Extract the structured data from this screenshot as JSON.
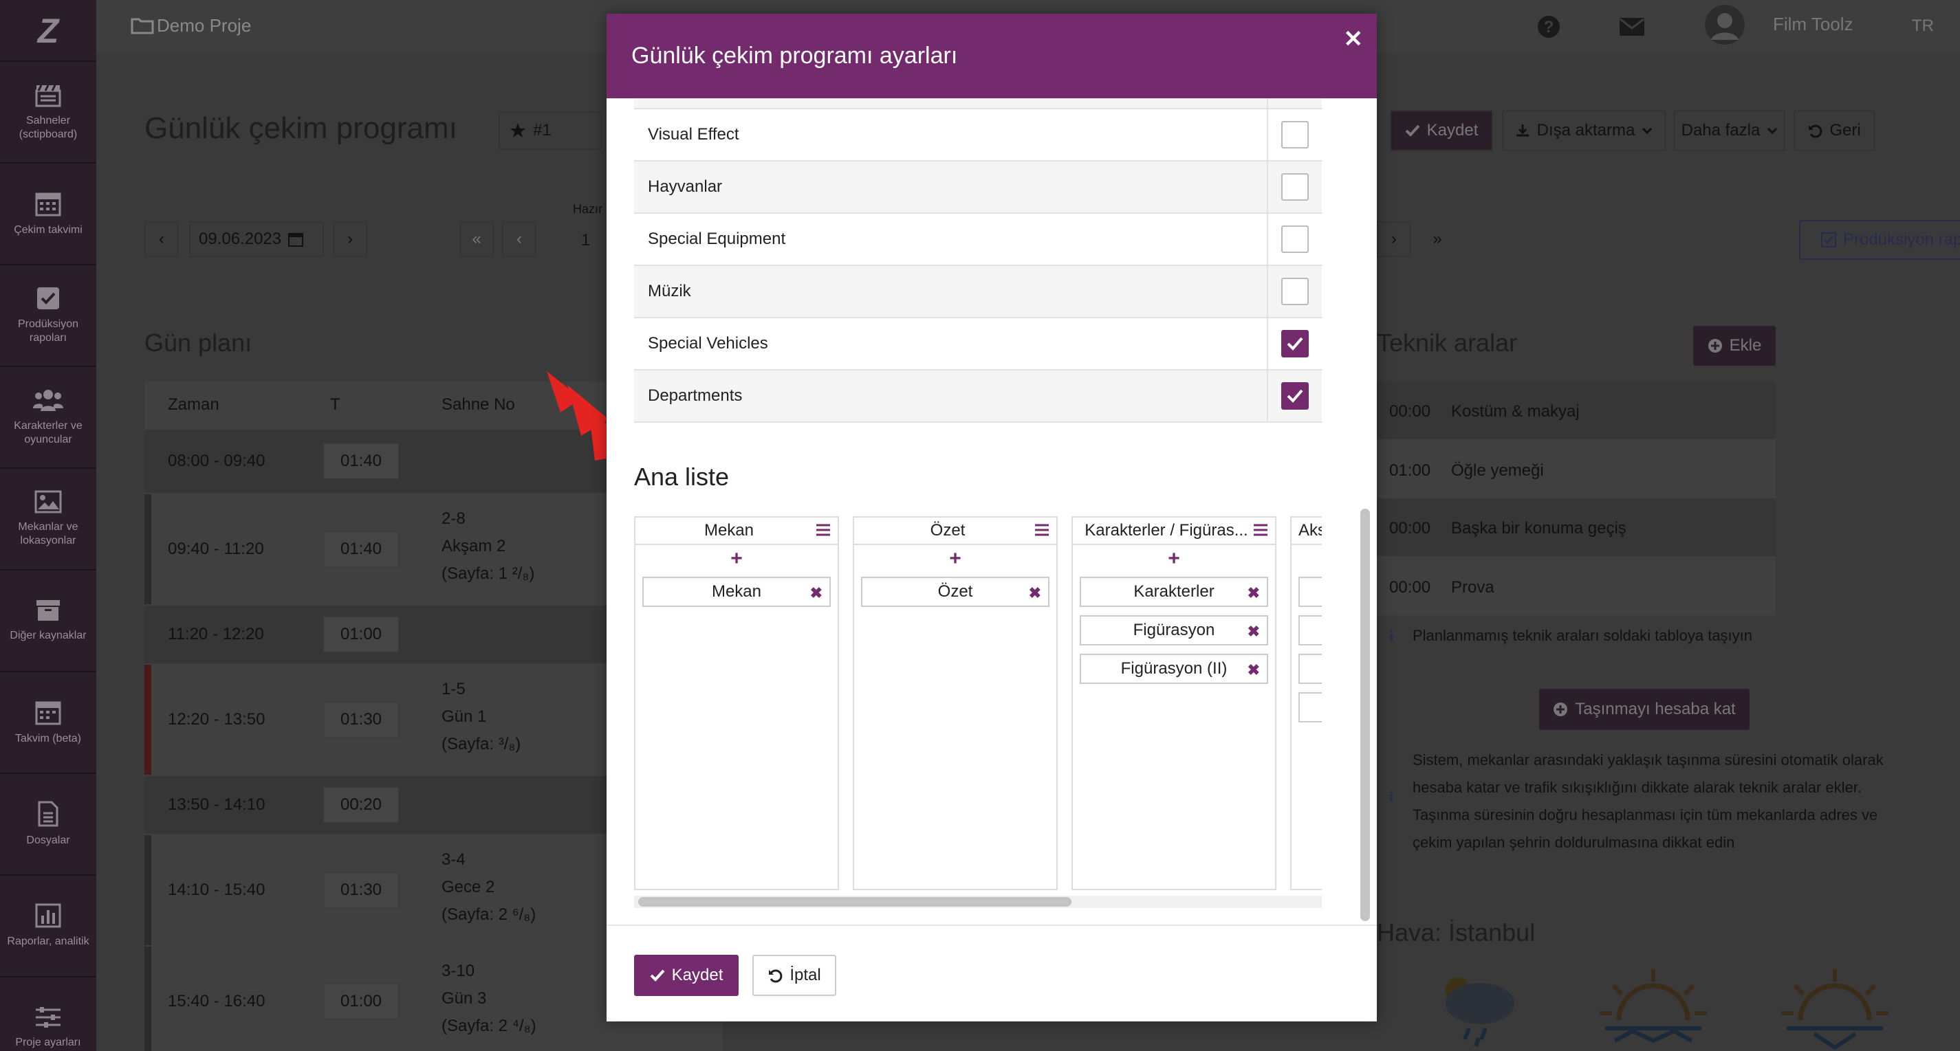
{
  "sidebar": {
    "logo": "Z",
    "items": [
      {
        "label": "Sahneler (sctipboard)",
        "icon": "clapperboard-icon"
      },
      {
        "label": "Çekim takvimi",
        "icon": "calendar-icon"
      },
      {
        "label": "Prodüksiyon rapoları",
        "icon": "checkbox-icon"
      },
      {
        "label": "Karakterler ve oyuncular",
        "icon": "users-icon"
      },
      {
        "label": "Mekanlar ve lokasyonlar",
        "icon": "image-icon"
      },
      {
        "label": "Diğer kaynaklar",
        "icon": "archive-icon"
      },
      {
        "label": "Takvim (beta)",
        "icon": "calendar-grid-icon"
      },
      {
        "label": "Dosyalar",
        "icon": "file-icon"
      },
      {
        "label": "Raporlar, analitik",
        "icon": "bar-chart-icon"
      },
      {
        "label": "Proje ayarları",
        "icon": "sliders-icon"
      }
    ]
  },
  "topbar": {
    "project": "Demo Proje",
    "user_name": "Film Toolz",
    "language": "TR"
  },
  "page": {
    "title": "Günlük çekim programı",
    "badge": "#1",
    "buttons": {
      "save": "Kaydet",
      "export": "Dışa aktarma",
      "more": "Daha fazla",
      "back": "Geri",
      "production_report": "Prodüksiyon raporu",
      "add": "Ekle"
    },
    "date": "09.06.2023",
    "prep_label": "Hazır",
    "day_number": "1"
  },
  "day_plan": {
    "title": "Gün planı",
    "columns": [
      "Zaman",
      "T",
      "Sahne No"
    ],
    "rows": [
      {
        "time": "08:00 - 09:40",
        "dur": "01:40",
        "scene": "",
        "desc": "",
        "page": ""
      },
      {
        "time": "09:40 - 11:20",
        "dur": "01:40",
        "scene": "2-8",
        "desc": "Akşam 2",
        "page": "(Sayfa: 1 ²/₈)"
      },
      {
        "time": "11:20 - 12:20",
        "dur": "01:00",
        "scene": "",
        "desc": "",
        "page": ""
      },
      {
        "time": "12:20 - 13:50",
        "dur": "01:30",
        "scene": "1-5",
        "desc": "Gün 1",
        "page": "(Sayfa: ³/₈)"
      },
      {
        "time": "13:50 - 14:10",
        "dur": "00:20",
        "scene": "",
        "desc": "",
        "page": ""
      },
      {
        "time": "14:10 - 15:40",
        "dur": "01:30",
        "scene": "3-4",
        "desc": "Gece 2",
        "page": "(Sayfa: 2 ⁶/₈)"
      },
      {
        "time": "15:40 - 16:40",
        "dur": "01:00",
        "scene": "3-10",
        "desc": "Gün 3",
        "page": "(Sayfa: 2 ⁴/₈)"
      }
    ]
  },
  "technical": {
    "title": "Teknik aralar",
    "items": [
      {
        "time": "00:00",
        "label": "Kostüm & makyaj"
      },
      {
        "time": "01:00",
        "label": "Öğle yemeği"
      },
      {
        "time": "00:00",
        "label": "Başka bir konuma geçiş"
      },
      {
        "time": "00:00",
        "label": "Prova"
      }
    ],
    "hint": "Planlanmamış teknik araları soldaki tabloya taşıyın",
    "move_button": "Taşınmayı hesaba kat",
    "info": "Sistem, mekanlar arasındaki yaklaşık taşınma süresini otomatik olarak hesaba katar ve trafik sıkışıklığını dikkate alarak teknik aralar ekler. Taşınma süresinin doğru hesaplanması için tüm mekanlarda adres ve çekim yapılan şehrin doldurulmasına dikkat edin"
  },
  "weather": {
    "title": "Hava: İstanbul"
  },
  "modal": {
    "title": "Günlük çekim programı ayarları",
    "options": [
      {
        "label": "Visual Effect",
        "checked": false
      },
      {
        "label": "Hayvanlar",
        "checked": false
      },
      {
        "label": "Special Equipment",
        "checked": false
      },
      {
        "label": "Müzik",
        "checked": false
      },
      {
        "label": "Special Vehicles",
        "checked": true
      },
      {
        "label": "Departments",
        "checked": true
      }
    ],
    "main_list_title": "Ana liste",
    "columns": [
      {
        "header": "Mekan",
        "items": [
          "Mekan"
        ]
      },
      {
        "header": "Özet",
        "items": [
          "Özet"
        ]
      },
      {
        "header": "Karakterler / Figüras...",
        "items": [
          "Karakterler",
          "Figürasyon",
          "Figürasyon (II)"
        ]
      },
      {
        "header": "Akse",
        "items": []
      }
    ],
    "save": "Kaydet",
    "cancel": "İptal"
  },
  "colors": {
    "accent": "#732b6d",
    "overlay_bg": "#3a3a3a",
    "arrow": "#e52421"
  }
}
